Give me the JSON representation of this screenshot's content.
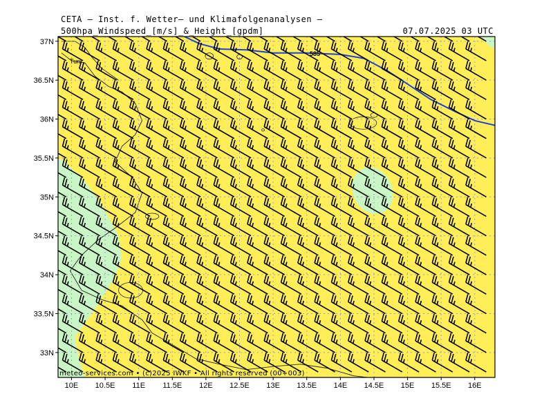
{
  "header": {
    "title": "CETA – Inst. f. Wetter– und Klimafolgenanalysen –",
    "subtitle": "500hpa_Windspeed_[m/s]_&_Height_[gpdm]",
    "datetime": "07.07.2025 03 UTC"
  },
  "map": {
    "lat_range": [
      32.68,
      37.06
    ],
    "lon_range": [
      9.8,
      16.3
    ],
    "lat_ticks": [
      "37N",
      "36.5N",
      "36N",
      "35.5N",
      "35N",
      "34.5N",
      "34N",
      "33.5N",
      "33N"
    ],
    "lon_ticks": [
      "10E",
      "10.5E",
      "11E",
      "11.5E",
      "12E",
      "12.5E",
      "13E",
      "13.5E",
      "14E",
      "14.5E",
      "15E",
      "15.5E",
      "16E"
    ],
    "contour_label": "585",
    "place_label": "Tuni",
    "copyright": "meteo-services.com • (c)2025 IWKF • All rights reserved (00+003)",
    "colors": {
      "background_fill": "#ffee58",
      "low_wind_fill": "#c8f7c5",
      "contour": "#2040d8",
      "coastline": "#202020",
      "grid": "#9a9ad0",
      "wind_barb": "#000000"
    },
    "wind": {
      "direction_from_deg": 300,
      "speed_kt": 25
    },
    "contour_585_path": [
      [
        11.68,
        37.06
      ],
      [
        11.9,
        36.97
      ],
      [
        12.2,
        36.9
      ],
      [
        12.6,
        36.89
      ],
      [
        13.0,
        36.85
      ],
      [
        13.5,
        36.85
      ],
      [
        14.0,
        36.83
      ],
      [
        14.35,
        36.78
      ],
      [
        14.7,
        36.62
      ],
      [
        15.0,
        36.45
      ],
      [
        15.35,
        36.25
      ],
      [
        15.7,
        36.1
      ],
      [
        16.0,
        35.98
      ],
      [
        16.3,
        35.92
      ]
    ],
    "low_wind_west_region": [
      [
        9.8,
        35.5
      ],
      [
        9.9,
        35.45
      ],
      [
        10.2,
        35.2
      ],
      [
        10.45,
        34.9
      ],
      [
        10.7,
        34.5
      ],
      [
        10.75,
        34.2
      ],
      [
        10.6,
        33.9
      ],
      [
        10.3,
        33.5
      ],
      [
        10.05,
        33.2
      ],
      [
        10.1,
        32.95
      ],
      [
        10.2,
        32.68
      ],
      [
        9.8,
        32.68
      ]
    ],
    "low_wind_ne_corner": [
      [
        16.1,
        37.06
      ],
      [
        16.3,
        37.06
      ],
      [
        16.3,
        36.9
      ],
      [
        16.2,
        36.95
      ]
    ],
    "low_wind_blob": {
      "lon": 14.48,
      "lat": 35.08,
      "rx_deg": 0.29,
      "ry_deg": 0.31
    },
    "coastlines": [
      [
        [
          9.85,
          36.85
        ],
        [
          10.0,
          36.75
        ],
        [
          10.2,
          36.72
        ],
        [
          10.35,
          36.55
        ],
        [
          10.55,
          36.42
        ],
        [
          10.75,
          36.35
        ],
        [
          10.95,
          36.2
        ],
        [
          11.05,
          35.98
        ],
        [
          10.95,
          35.8
        ],
        [
          10.75,
          35.65
        ],
        [
          10.65,
          35.45
        ],
        [
          10.9,
          35.25
        ],
        [
          11.05,
          35.05
        ],
        [
          10.95,
          34.8
        ],
        [
          10.65,
          34.6
        ],
        [
          10.4,
          34.45
        ],
        [
          10.15,
          34.25
        ],
        [
          9.98,
          34.05
        ],
        [
          10.15,
          33.8
        ],
        [
          10.45,
          33.68
        ],
        [
          10.75,
          33.6
        ],
        [
          11.05,
          33.42
        ],
        [
          11.2,
          33.25
        ],
        [
          11.5,
          33.1
        ],
        [
          11.85,
          32.92
        ],
        [
          12.2,
          32.85
        ],
        [
          12.6,
          32.78
        ],
        [
          13.0,
          32.82
        ],
        [
          13.4,
          32.85
        ],
        [
          13.8,
          32.8
        ],
        [
          14.2,
          32.7
        ],
        [
          14.4,
          32.68
        ]
      ],
      [
        [
          9.85,
          37.0
        ],
        [
          10.05,
          37.0
        ],
        [
          10.2,
          36.92
        ],
        [
          10.3,
          36.8
        ],
        [
          10.45,
          36.65
        ],
        [
          10.7,
          36.5
        ]
      ]
    ],
    "islands": [
      {
        "lon": 12.05,
        "lat": 36.81,
        "rx_deg": 0.06,
        "ry_deg": 0.04
      },
      {
        "lon": 12.5,
        "lat": 36.8,
        "rx_deg": 0.04,
        "ry_deg": 0.03
      },
      {
        "lon": 14.34,
        "lat": 35.95,
        "rx_deg": 0.2,
        "ry_deg": 0.08
      },
      {
        "lon": 14.5,
        "lat": 36.05,
        "rx_deg": 0.05,
        "ry_deg": 0.03
      },
      {
        "lon": 12.85,
        "lat": 35.86,
        "rx_deg": 0.02,
        "ry_deg": 0.015
      },
      {
        "lon": 11.2,
        "lat": 34.75,
        "rx_deg": 0.1,
        "ry_deg": 0.04
      },
      {
        "lon": 10.88,
        "lat": 33.8,
        "rx_deg": 0.18,
        "ry_deg": 0.1
      }
    ]
  }
}
